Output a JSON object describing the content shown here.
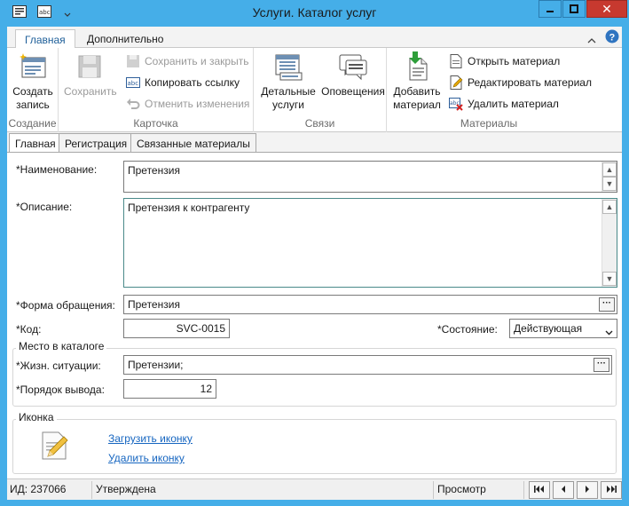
{
  "window": {
    "title": "Услуги. Каталог услуг"
  },
  "ribbon_tabs": [
    {
      "label": "Главная"
    },
    {
      "label": "Дополнительно"
    }
  ],
  "ribbon": {
    "create": {
      "label": "Создать запись",
      "line1": "Создать",
      "line2": "запись",
      "group": "Создание"
    },
    "card": {
      "group": "Карточка",
      "save": "Сохранить",
      "save_close": "Сохранить и закрыть",
      "copy_link": "Копировать ссылку",
      "cancel_changes": "Отменить изменения"
    },
    "links": {
      "group": "Связи",
      "details_l1": "Детальные",
      "details_l2": "услуги",
      "notifications": "Оповещения"
    },
    "materials": {
      "group": "Материалы",
      "add_l1": "Добавить",
      "add_l2": "материал",
      "open": "Открыть материал",
      "edit": "Редактировать материал",
      "delete": "Удалить материал"
    }
  },
  "form_tabs": [
    {
      "label": "Главная"
    },
    {
      "label": "Регистрация"
    },
    {
      "label": "Связанные материалы"
    }
  ],
  "form": {
    "name_label": "*Наименование:",
    "name_value": "Претензия",
    "description_label": "*Описание:",
    "description_value": "Претензия к контрагенту",
    "request_form_label": "*Форма обращения:",
    "request_form_value": "Претензия",
    "code_label": "*Код:",
    "code_value": "SVC-0015",
    "state_label": "*Состояние:",
    "state_value": "Действующая",
    "catalog_group": "Место в каталоге",
    "life_situation_label": "*Жизн. ситуации:",
    "life_situation_value": "Претензии;",
    "order_label": "*Порядок вывода:",
    "order_value": "12",
    "icon_group": "Иконка",
    "upload_icon": "Загрузить иконку",
    "delete_icon": "Удалить иконку"
  },
  "status_bar": {
    "id": "ИД: 237066",
    "state": "Утверждена",
    "mode": "Просмотр"
  },
  "colors": {
    "titlebar": "#45aee8",
    "close": "#c7392f",
    "link": "#1565c0",
    "accent_tab": "#1e5f99"
  }
}
